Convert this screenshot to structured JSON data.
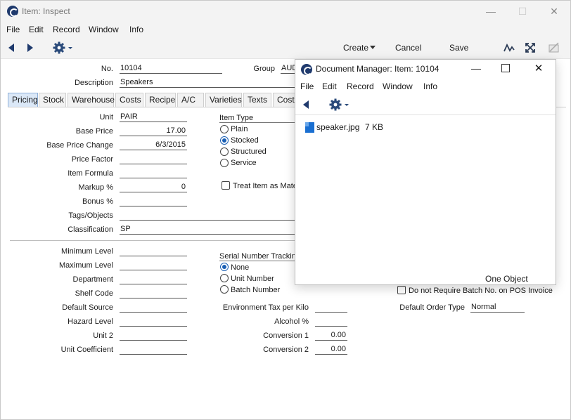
{
  "window": {
    "title": "Item: Inspect",
    "minimize": "—",
    "maximize": "☐",
    "close": "✕"
  },
  "menu": [
    "File",
    "Edit",
    "Record",
    "Window",
    "Info"
  ],
  "toolbar": {
    "create_label": "Create",
    "cancel_label": "Cancel",
    "save_label": "Save"
  },
  "header": {
    "no_label": "No.",
    "no_value": "10104",
    "group_label": "Group",
    "group_value": "AUD",
    "description_label": "Description",
    "description_value": "Speakers"
  },
  "tabs": [
    "Pricing",
    "Stock",
    "Warehouse",
    "Costs",
    "Recipe",
    "A/C",
    "Varieties",
    "Texts",
    "Cost M"
  ],
  "pricing": {
    "unit_label": "Unit",
    "unit_value": "PAIR",
    "base_price_label": "Base Price",
    "base_price_value": "17.00",
    "base_price_change_label": "Base Price Change",
    "base_price_change_value": "6/3/2015",
    "price_factor_label": "Price Factor",
    "price_factor_value": "",
    "item_formula_label": "Item Formula",
    "item_formula_value": "",
    "markup_label": "Markup %",
    "markup_value": "0",
    "bonus_label": "Bonus %",
    "bonus_value": "",
    "tags_label": "Tags/Objects",
    "tags_value": "",
    "classification_label": "Classification",
    "classification_value": "SP",
    "item_type_label": "Item Type",
    "item_type_options": [
      "Plain",
      "Stocked",
      "Structured",
      "Service"
    ],
    "item_type_selected": "Stocked",
    "treat_item_label": "Treat Item as Mate"
  },
  "lower": {
    "minimum_level_label": "Minimum Level",
    "maximum_level_label": "Maximum Level",
    "department_label": "Department",
    "shelf_code_label": "Shelf Code",
    "default_source_label": "Default Source",
    "hazard_level_label": "Hazard Level",
    "unit2_label": "Unit 2",
    "unit_coefficient_label": "Unit Coefficient",
    "serial_tracking_label": "Serial Number Tracking",
    "serial_options": [
      "None",
      "Unit Number",
      "Batch Number"
    ],
    "serial_selected": "None",
    "env_tax_label": "Environment Tax per Kilo",
    "alcohol_label": "Alcohol %",
    "conversion1_label": "Conversion 1",
    "conversion1_value": "0.00",
    "conversion2_label": "Conversion 2",
    "conversion2_value": "0.00",
    "no_batch_pos_label": "Do not Require Batch No. on POS Invoice",
    "default_order_type_label": "Default Order Type",
    "default_order_type_value": "Normal"
  },
  "doc_manager": {
    "title": "Document Manager: Item: 10104",
    "menu": [
      "File",
      "Edit",
      "Record",
      "Window",
      "Info"
    ],
    "file_name": "speaker.jpg",
    "file_size": "7 KB",
    "status": "One Object"
  },
  "colors": {
    "accent": "#1a5fb4",
    "active_tab": "#dbe8f7",
    "chrome": "#f3f3f3"
  }
}
